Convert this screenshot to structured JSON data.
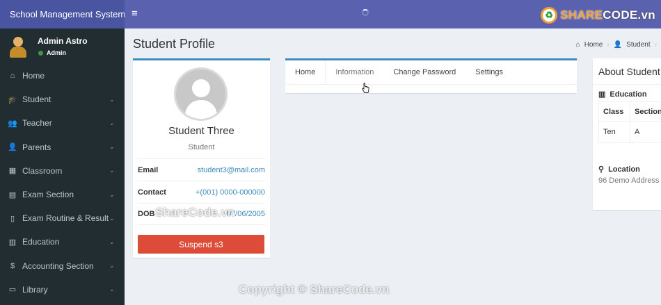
{
  "header": {
    "brand": "School Management System",
    "logo_text_main": "SHARE",
    "logo_text_rest": "CODE.vn"
  },
  "user": {
    "name": "Admin Astro",
    "role": "Admin"
  },
  "sidebar": {
    "items": [
      {
        "label": "Home",
        "icon": "dashboard-icon",
        "glyph": "⌂",
        "expandable": false
      },
      {
        "label": "Student",
        "icon": "graduation-cap-icon",
        "glyph": "🎓",
        "expandable": true
      },
      {
        "label": "Teacher",
        "icon": "users-icon",
        "glyph": "👥",
        "expandable": true
      },
      {
        "label": "Parents",
        "icon": "user-icon",
        "glyph": "👤",
        "expandable": true
      },
      {
        "label": "Classroom",
        "icon": "grid-icon",
        "glyph": "▦",
        "expandable": true
      },
      {
        "label": "Exam Section",
        "icon": "edit-icon",
        "glyph": "▤",
        "expandable": true
      },
      {
        "label": "Exam Routine & Result",
        "icon": "file-icon",
        "glyph": "▯",
        "expandable": true
      },
      {
        "label": "Education",
        "icon": "book-icon",
        "glyph": "▥",
        "expandable": true
      },
      {
        "label": "Accounting Section",
        "icon": "dollar-icon",
        "glyph": "$",
        "expandable": true
      },
      {
        "label": "Library",
        "icon": "library-icon",
        "glyph": "▭",
        "expandable": true
      }
    ]
  },
  "page": {
    "title": "Student Profile",
    "breadcrumb": [
      "Home",
      "Student"
    ]
  },
  "profile": {
    "name": "Student Three",
    "role": "Student",
    "email_label": "Email",
    "email": "student3@mail.com",
    "contact_label": "Contact",
    "contact": "+(001) 0000-000000",
    "dob_label": "DOB",
    "dob": "07/06/2005",
    "suspend_label": "Suspend s3"
  },
  "tabs": [
    "Home",
    "Information",
    "Change Password",
    "Settings"
  ],
  "about": {
    "title": "About Student",
    "education_label": "Education",
    "table_headers": [
      "Class",
      "Section"
    ],
    "table_row": [
      "Ten",
      "A"
    ],
    "location_label": "Location",
    "address": "96 Demo Address"
  },
  "overlay": {
    "watermark": "ShareCode.vn",
    "copyright": "Copyright © ShareCode.vn"
  },
  "colors": {
    "brand_bg": "#4a55a2",
    "topbar_bg": "#5a62b0",
    "sidebar_bg": "#222d32",
    "accent": "#3c8dbc",
    "danger": "#dd4b39"
  }
}
